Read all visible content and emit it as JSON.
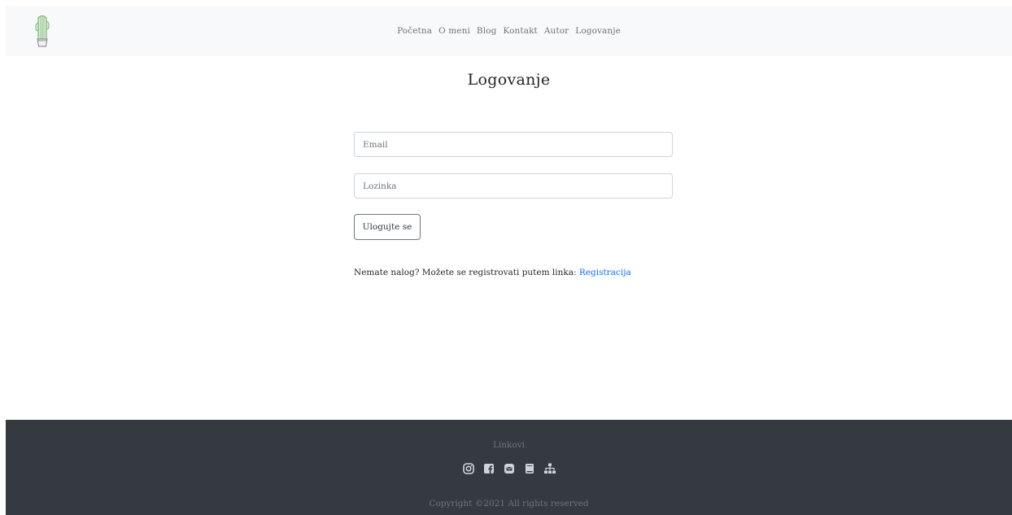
{
  "nav": {
    "logo_icon": "cactus-icon",
    "items": [
      {
        "label": "Početna"
      },
      {
        "label": "O meni"
      },
      {
        "label": "Blog"
      },
      {
        "label": "Kontakt"
      },
      {
        "label": "Autor"
      },
      {
        "label": "Logovanje"
      }
    ]
  },
  "main": {
    "title": "Logovanje",
    "email_placeholder": "Email",
    "password_placeholder": "Lozinka",
    "login_button": "Ulogujte se",
    "register_text": "Nemate nalog? Možete se registrovati putem linka: ",
    "register_link": "Registracija"
  },
  "footer": {
    "title": "Linkovi",
    "icons": [
      "instagram-icon",
      "facebook-icon",
      "contact-icon",
      "book-icon",
      "sitemap-icon"
    ],
    "copyright": "Copyright ©2021 All rights reserved"
  },
  "colors": {
    "navbar_bg": "#f8f9fa",
    "footer_bg": "#343a40",
    "link": "#0d6efd"
  }
}
